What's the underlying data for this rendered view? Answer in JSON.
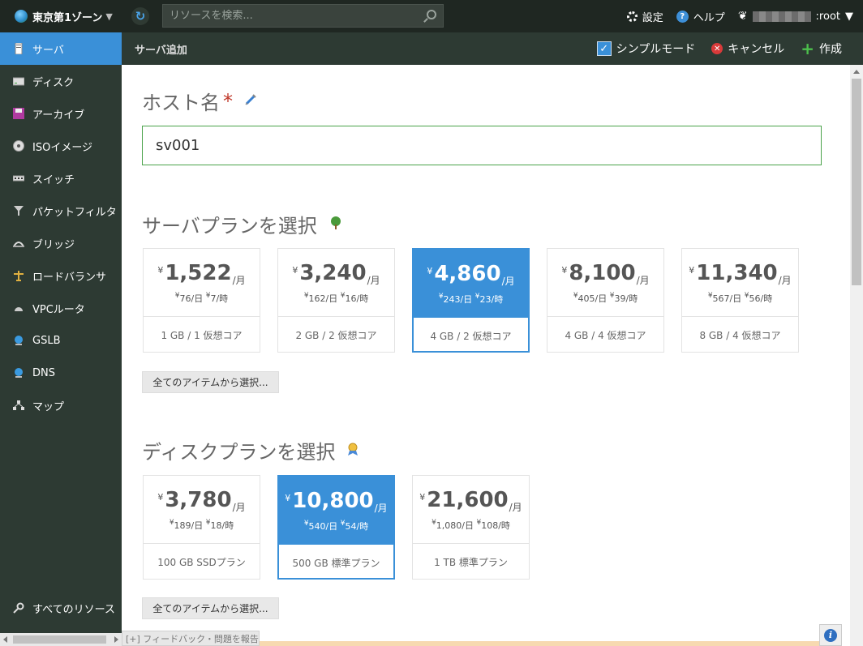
{
  "topbar": {
    "zone": "東京第1ゾーン",
    "search_placeholder": "リソースを検索...",
    "settings": "設定",
    "help": "ヘルプ",
    "user_suffix": ":root"
  },
  "sidebar": {
    "items": [
      {
        "label": "サーバ",
        "icon": "server-icon"
      },
      {
        "label": "ディスク",
        "icon": "disk-icon"
      },
      {
        "label": "アーカイブ",
        "icon": "archive-icon"
      },
      {
        "label": "ISOイメージ",
        "icon": "iso-image-icon"
      },
      {
        "label": "スイッチ",
        "icon": "switch-icon"
      },
      {
        "label": "パケットフィルタ",
        "icon": "packet-filter-icon"
      },
      {
        "label": "ブリッジ",
        "icon": "bridge-icon"
      },
      {
        "label": "ロードバランサ",
        "icon": "load-balancer-icon"
      },
      {
        "label": "VPCルータ",
        "icon": "vpc-router-icon"
      },
      {
        "label": "GSLB",
        "icon": "gslb-icon"
      },
      {
        "label": "DNS",
        "icon": "dns-icon"
      },
      {
        "label": "マップ",
        "icon": "map-icon"
      }
    ],
    "all_resources": "すべてのリソース"
  },
  "subbar": {
    "title": "サーバ追加",
    "simple_mode": "シンプルモード",
    "cancel": "キャンセル",
    "create": "作成"
  },
  "host": {
    "title": "ホスト名",
    "required_mark": "*",
    "value": "sv001"
  },
  "server_plans": {
    "title": "サーバプラン を選択",
    "title_text": "サーバプランを選択",
    "pick_all": "全てのアイテムから選択...",
    "plans": [
      {
        "amount": "1,522",
        "per_day": "76/日",
        "per_hour": "7/時",
        "spec": "1 GB / 1 仮想コア"
      },
      {
        "amount": "3,240",
        "per_day": "162/日",
        "per_hour": "16/時",
        "spec": "2 GB / 2 仮想コア"
      },
      {
        "amount": "4,860",
        "per_day": "243/日",
        "per_hour": "23/時",
        "spec": "4 GB / 2 仮想コア"
      },
      {
        "amount": "8,100",
        "per_day": "405/日",
        "per_hour": "39/時",
        "spec": "4 GB / 4 仮想コア"
      },
      {
        "amount": "11,340",
        "per_day": "567/日",
        "per_hour": "56/時",
        "spec": "8 GB / 4 仮想コア"
      }
    ],
    "selected_index": 2
  },
  "disk_plans": {
    "title_text": "ディスクプランを選択",
    "pick_all": "全てのアイテムから選択...",
    "plans": [
      {
        "amount": "3,780",
        "per_day": "189/日",
        "per_hour": "18/時",
        "spec": "100 GB SSDプラン"
      },
      {
        "amount": "10,800",
        "per_day": "540/日",
        "per_hour": "54/時",
        "spec": "500 GB 標準プラン"
      },
      {
        "amount": "21,600",
        "per_day": "1,080/日",
        "per_hour": "108/時",
        "spec": "1 TB 標準プラン"
      }
    ],
    "selected_index": 1
  },
  "common": {
    "yen": "¥",
    "per_month": "/月"
  },
  "footer": {
    "feedback": "[+] フィードバック・問題を報告"
  },
  "colors": {
    "accent": "#3a90d8",
    "sidebar_bg": "#2d3a33",
    "topbar_bg": "#1f2722",
    "valid_border": "#4aa24a",
    "required": "#c0392b"
  }
}
